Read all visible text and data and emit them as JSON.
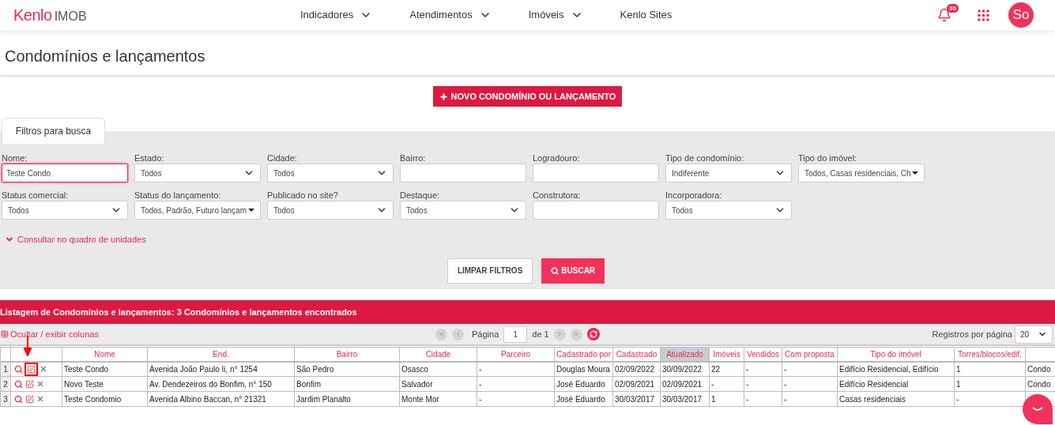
{
  "brand": {
    "name": "Kenlo",
    "product": "IMOB"
  },
  "nav": [
    {
      "label": "Indicadores",
      "dropdown": true
    },
    {
      "label": "Atendimentos",
      "dropdown": true
    },
    {
      "label": "Imóveis",
      "dropdown": true
    },
    {
      "label": "Kenlo Sites",
      "dropdown": false
    }
  ],
  "notifications": {
    "count": "30"
  },
  "avatar": {
    "initials": "So"
  },
  "page_title": "Condomínios e lançamentos",
  "new_button": "NOVO CONDOMÍNIO OU LANÇAMENTO",
  "filters_tab": "Filtros para busca",
  "filters": [
    {
      "kind": "text",
      "label": "Nome:",
      "value": "Teste Condo",
      "focused": true
    },
    {
      "kind": "select",
      "label": "Estado:",
      "value": "Todos",
      "focused": false
    },
    {
      "kind": "select",
      "label": "Cidade:",
      "value": "Todos",
      "focused": false
    },
    {
      "kind": "text",
      "label": "Bairro:",
      "focused": false
    },
    {
      "kind": "text",
      "label": "Logradouro:",
      "focused": false
    },
    {
      "kind": "select",
      "label": "Tipo de condomínio:",
      "value": "Indiferente",
      "focused": false
    },
    {
      "kind": "multi",
      "label": "Tipo do imóvel:",
      "value": "Todos, Casas residenciais, Ch",
      "focused": false
    },
    {
      "kind": "select",
      "label": "Status comercial:",
      "value": "Todos",
      "focused": false
    },
    {
      "kind": "multi",
      "label": "Status do lançamento:",
      "value": "Todos, Padrão, Futuro lançam",
      "focused": false
    },
    {
      "kind": "select",
      "label": "Publicado no site?",
      "value": "Todos",
      "focused": false
    },
    {
      "kind": "select",
      "label": "Destaque:",
      "value": "Todos",
      "focused": false
    },
    {
      "kind": "text",
      "label": "Construtora:",
      "focused": false
    },
    {
      "kind": "select",
      "label": "Incorporadora:",
      "value": "Todos",
      "focused": false
    }
  ],
  "units_link": "Consultar no quadro de unidades",
  "clear_button": "LIMPAR FILTROS",
  "search_button": "BUSCAR",
  "listing_title": "Listagem de Condomínios e lançamentos: 3 Condomínios e lançamentos encontrados",
  "columns_toggle": "Ocultar / exibir colunas",
  "pager": {
    "page_label": "Página",
    "page": "1",
    "of": "de 1"
  },
  "per_page": {
    "label": "Registros por página",
    "value": "20"
  },
  "columns": [
    {
      "label": "Nome",
      "sorted": false
    },
    {
      "label": "End.",
      "sorted": false
    },
    {
      "label": "Bairro",
      "sorted": false
    },
    {
      "label": "Cidade",
      "sorted": false
    },
    {
      "label": "Parceiro",
      "sorted": false
    },
    {
      "label": "Cadastrado por",
      "sorted": false
    },
    {
      "label": "Cadastrado",
      "sorted": false
    },
    {
      "label": "Atualizado",
      "sorted": true
    },
    {
      "label": "Imóveis",
      "sorted": false
    },
    {
      "label": "Vendidos",
      "sorted": false
    },
    {
      "label": "Com proposta",
      "sorted": false
    },
    {
      "label": "Tipo do imóvel",
      "sorted": false
    },
    {
      "label": "Torres/blocos/edif.",
      "sorted": false
    }
  ],
  "rows": [
    {
      "number": "1",
      "edit_highlighted": true,
      "cells": [
        "Teste Condo",
        "Avenida João Paulo Ii, n° 1254",
        "São Pedro",
        "Osasco",
        "-",
        "Douglas Moura",
        "02/09/2022",
        "30/09/2022",
        "22",
        "-",
        "-",
        "Edifício Residencial, Edifício",
        "1",
        "Condo"
      ]
    },
    {
      "number": "2",
      "edit_highlighted": false,
      "cells": [
        "Novo Teste",
        "Av. Dendezeiros do Bonfim, n° 150",
        "Bonfim",
        "Salvador",
        "-",
        "José Eduardo",
        "02/09/2021",
        "02/09/2021",
        "-",
        "-",
        "-",
        "Edifício Residencial",
        "1",
        "Condo"
      ]
    },
    {
      "number": "3",
      "edit_highlighted": false,
      "cells": [
        "Teste Condomio",
        "Avenida Albino Baccan, n° 21321",
        "Jardim Planalto",
        "Monte Mor",
        "-",
        "José Eduardo",
        "30/03/2017",
        "30/03/2017",
        "1",
        "-",
        "-",
        "Casas residenciais",
        "-"
      ]
    }
  ]
}
